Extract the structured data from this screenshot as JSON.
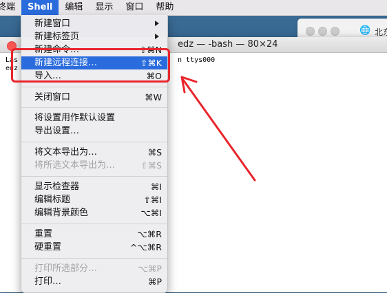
{
  "menubar": {
    "items": [
      "终端",
      "Shell",
      "编辑",
      "显示",
      "窗口",
      "帮助"
    ]
  },
  "terminal": {
    "title": "edz — -bash — 80×24",
    "line1_start": "Las",
    "line1_end": "n ttys000",
    "line2_start": "edz"
  },
  "bg_window": {
    "text": "北东"
  },
  "shell_menu": {
    "items": [
      {
        "label": "新建窗口",
        "shortcut": "",
        "submenu": true
      },
      {
        "label": "新建标签页",
        "shortcut": "",
        "submenu": true
      },
      {
        "label": "新建命令…",
        "shortcut": "⇧⌘N"
      },
      {
        "label": "新建远程连接…",
        "shortcut": "⇧⌘K"
      },
      {
        "label": "导入…",
        "shortcut": "⌘O"
      },
      {
        "label": "关闭窗口",
        "shortcut": "⌘W"
      },
      {
        "label": "将设置用作默认设置",
        "shortcut": ""
      },
      {
        "label": "导出设置…",
        "shortcut": ""
      },
      {
        "label": "将文本导出为…",
        "shortcut": "⌘S"
      },
      {
        "label": "将所选文本导出为…",
        "shortcut": "⇧⌘S"
      },
      {
        "label": "显示检查器",
        "shortcut": "⌘I"
      },
      {
        "label": "编辑标题",
        "shortcut": "⇧⌘I"
      },
      {
        "label": "编辑背景颜色",
        "shortcut": "⌥⌘I"
      },
      {
        "label": "重置",
        "shortcut": "⌥⌘R"
      },
      {
        "label": "硬重置",
        "shortcut": "^⌥⌘R"
      },
      {
        "label": "打印所选部分…",
        "shortcut": "⌥⌘P"
      },
      {
        "label": "打印…",
        "shortcut": "⌘P"
      }
    ]
  },
  "colors": {
    "highlight": "#2a6cdd",
    "annotation": "#e8252b"
  }
}
